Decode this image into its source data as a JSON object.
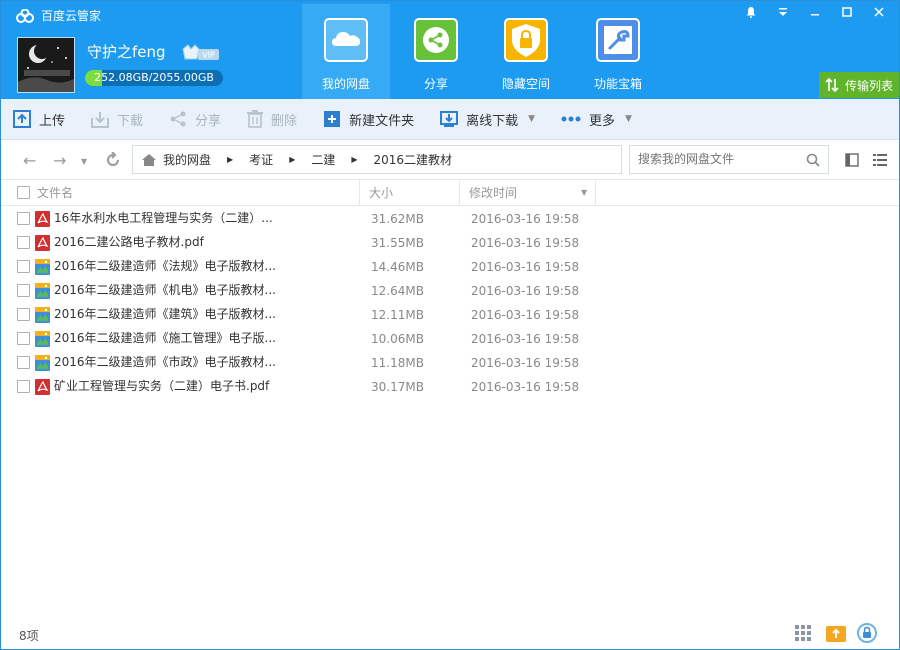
{
  "app": {
    "title": "百度云管家"
  },
  "user": {
    "name": "守护之feng",
    "quota_text": "252.08GB/2055.00GB",
    "quota_fraction": 0.1227,
    "vip_label": "VIP"
  },
  "nav": {
    "tabs": [
      {
        "label": "我的网盘",
        "icon": "cloud-icon"
      },
      {
        "label": "分享",
        "icon": "share-icon"
      },
      {
        "label": "隐藏空间",
        "icon": "lock-icon"
      },
      {
        "label": "功能宝箱",
        "icon": "toolbox-icon"
      }
    ]
  },
  "transfer": {
    "label": "传输列表"
  },
  "toolbar": {
    "upload": "上传",
    "download": "下载",
    "share": "分享",
    "delete": "删除",
    "new_folder": "新建文件夹",
    "offline": "离线下载",
    "more": "更多"
  },
  "breadcrumb": {
    "items": [
      "我的网盘",
      "考证",
      "二建",
      "2016二建教材"
    ]
  },
  "search": {
    "placeholder": "搜索我的网盘文件"
  },
  "table": {
    "headers": {
      "name": "文件名",
      "size": "大小",
      "modified": "修改时间"
    },
    "rows": [
      {
        "name": "16年水利水电工程管理与实务（二建）...",
        "size": "31.62MB",
        "time": "2016-03-16 19:58",
        "type": "pdf"
      },
      {
        "name": "2016二建公路电子教材.pdf",
        "size": "31.55MB",
        "time": "2016-03-16 19:58",
        "type": "pdf"
      },
      {
        "name": "2016年二级建造师《法规》电子版教材...",
        "size": "14.46MB",
        "time": "2016-03-16 19:58",
        "type": "img"
      },
      {
        "name": "2016年二级建造师《机电》电子版教材...",
        "size": "12.64MB",
        "time": "2016-03-16 19:58",
        "type": "img"
      },
      {
        "name": "2016年二级建造师《建筑》电子版教材...",
        "size": "12.11MB",
        "time": "2016-03-16 19:58",
        "type": "img"
      },
      {
        "name": "2016年二级建造师《施工管理》电子版...",
        "size": "10.06MB",
        "time": "2016-03-16 19:58",
        "type": "img"
      },
      {
        "name": "2016年二级建造师《市政》电子版教材...",
        "size": "11.18MB",
        "time": "2016-03-16 19:58",
        "type": "img"
      },
      {
        "name": "矿业工程管理与实务（二建）电子书.pdf",
        "size": "30.17MB",
        "time": "2016-03-16 19:58",
        "type": "pdf"
      }
    ]
  },
  "status": {
    "count": "8项"
  },
  "colors": {
    "header": "#1c9bf0",
    "active_tab": "#37aaf5",
    "transfer": "#5fb42a",
    "quota_fill": "#7ddc3e"
  }
}
